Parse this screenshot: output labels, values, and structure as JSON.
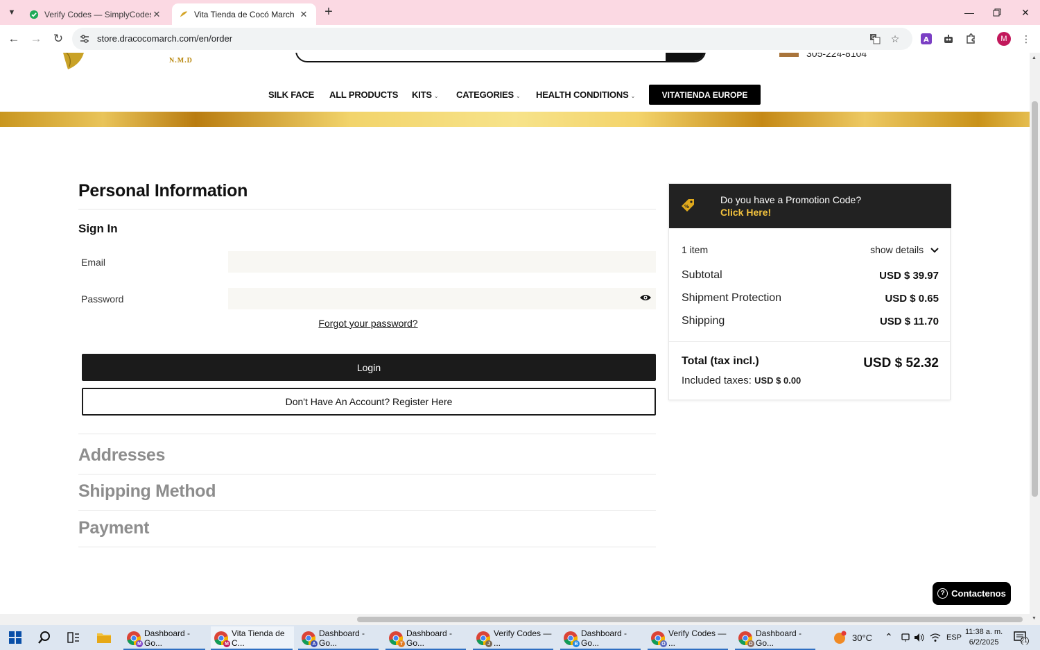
{
  "browser": {
    "tabs": [
      {
        "title": "Verify Codes — SimplyCodes",
        "active": false
      },
      {
        "title": "Vita Tienda de Cocó March",
        "active": true
      }
    ],
    "url": "store.dracocomarch.com/en/order"
  },
  "header": {
    "logo_subtext": "N.M.D",
    "phone": "305-224-8104",
    "nav": [
      {
        "label": "SILK FACE",
        "has_dropdown": false
      },
      {
        "label": "ALL PRODUCTS",
        "has_dropdown": false
      },
      {
        "label": "KITS",
        "has_dropdown": true
      },
      {
        "label": "CATEGORIES",
        "has_dropdown": true
      },
      {
        "label": "HEALTH CONDITIONS",
        "has_dropdown": true
      }
    ],
    "nav_cta": "VITATIENDA EUROPE"
  },
  "checkout": {
    "title": "Personal Information",
    "signin_title": "Sign In",
    "email_label": "Email",
    "email_value": "",
    "password_label": "Password",
    "password_value": "",
    "forgot": "Forgot your password?",
    "login": "Login",
    "register": "Don't Have An Account? Register Here",
    "sections": [
      "Addresses",
      "Shipping Method",
      "Payment"
    ]
  },
  "summary": {
    "promo_question": "Do you have a Promotion Code?",
    "promo_cta": "Click Here!",
    "items_count": "1 item",
    "show_details": "show details",
    "subtotal_label": "Subtotal",
    "subtotal_value": "USD $ 39.97",
    "protection_label": "Shipment Protection",
    "protection_value": "USD $ 0.65",
    "shipping_label": "Shipping",
    "shipping_value": "USD $ 11.70",
    "total_label": "Total (tax incl.)",
    "total_value": "USD $ 52.32",
    "taxes_label": "Included taxes:",
    "taxes_value": "USD $ 0.00"
  },
  "contact_button": "Contactenos",
  "taskbar": {
    "apps": [
      {
        "label": "Dashboard - Go...",
        "badge": "M",
        "badge_color": "#7b3fc4"
      },
      {
        "label": "Vita Tienda de C...",
        "badge": "M",
        "badge_color": "#c2185b"
      },
      {
        "label": "Dashboard - Go...",
        "badge": "A",
        "badge_color": "#3f51b5"
      },
      {
        "label": "Dashboard - Go...",
        "badge": "T",
        "badge_color": "#e07b24"
      },
      {
        "label": "Verify Codes — ...",
        "badge": "J",
        "badge_color": "#7a6a55"
      },
      {
        "label": "Dashboard - Go...",
        "badge": "B",
        "badge_color": "#1e88e5"
      },
      {
        "label": "Verify Codes — ...",
        "badge": "O",
        "badge_color": "#5c6bc0"
      },
      {
        "label": "Dashboard - Go...",
        "badge": "D",
        "badge_color": "#8d6e63"
      }
    ],
    "weather": "30°C",
    "language": "ESP",
    "time": "11:38 a. m.",
    "date": "6/2/2025",
    "notifications": "21"
  },
  "colors": {
    "accent_gold": "#f2c23e",
    "dark": "#1b1b1b",
    "tab_strip": "#fbd9e3"
  }
}
